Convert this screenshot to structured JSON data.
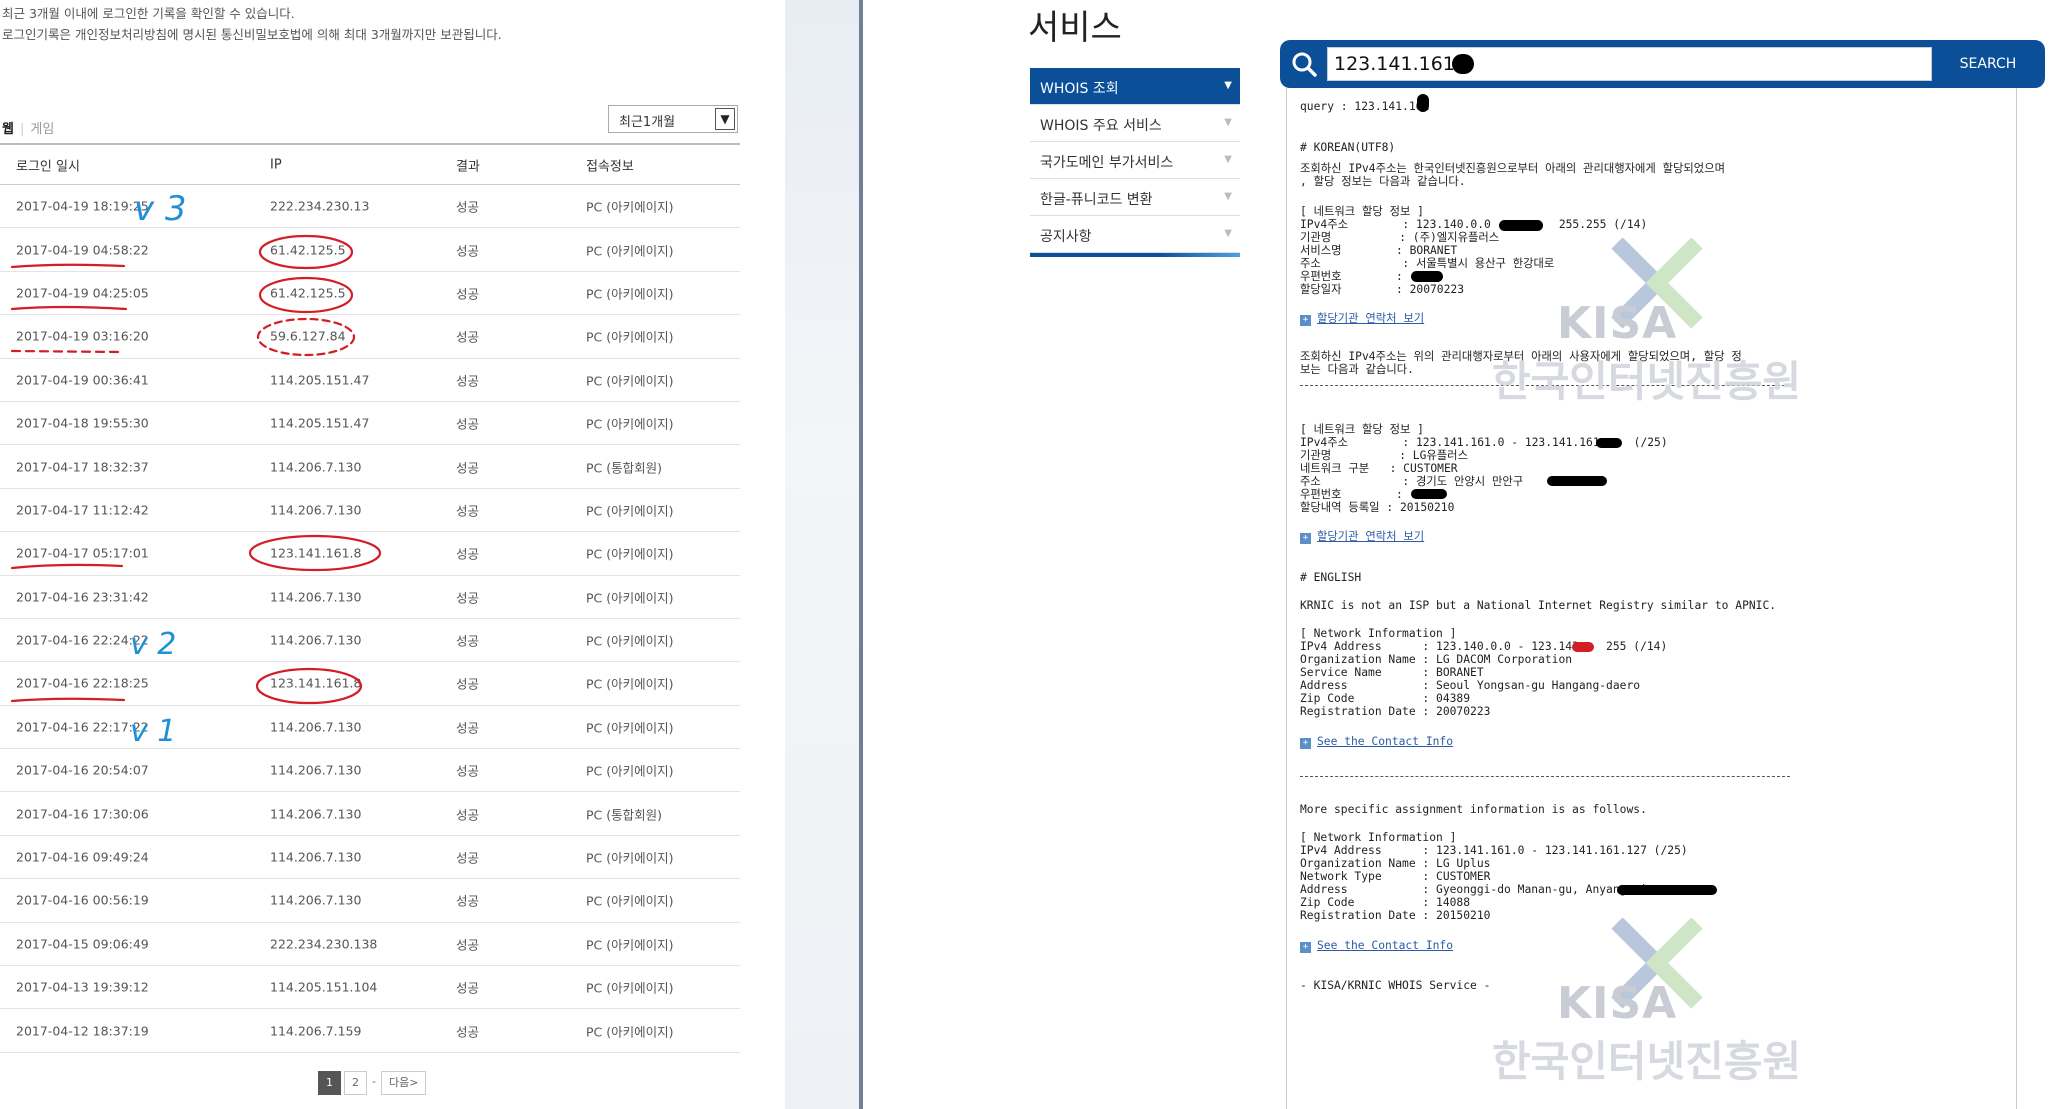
{
  "left": {
    "notice_line1": "최근 3개월 이내에 로그인한 기록을 확인할 수 있습니다.",
    "notice_line2": "로그인기록은 개인정보처리방침에 명시된 통신비밀보호법에 의해 최대 3개월까지만 보관됩니다.",
    "tabs": [
      "웹",
      "게임"
    ],
    "period_select": "최근1개월",
    "columns": [
      "로그인 일시",
      "IP",
      "결과",
      "접속정보"
    ],
    "rows": [
      {
        "time": "2017-04-19 18:19:25",
        "ip": "222.234.230.13",
        "result": "성공",
        "device": "PC (아키에이지)"
      },
      {
        "time": "2017-04-19 04:58:22",
        "ip": "61.42.125.5",
        "result": "성공",
        "device": "PC (아키에이지)"
      },
      {
        "time": "2017-04-19 04:25:05",
        "ip": "61.42.125.5",
        "result": "성공",
        "device": "PC (아키에이지)"
      },
      {
        "time": "2017-04-19 03:16:20",
        "ip": "59.6.127.84",
        "result": "성공",
        "device": "PC (아키에이지)"
      },
      {
        "time": "2017-04-19 00:36:41",
        "ip": "114.205.151.47",
        "result": "성공",
        "device": "PC (아키에이지)"
      },
      {
        "time": "2017-04-18 19:55:30",
        "ip": "114.205.151.47",
        "result": "성공",
        "device": "PC (아키에이지)"
      },
      {
        "time": "2017-04-17 18:32:37",
        "ip": "114.206.7.130",
        "result": "성공",
        "device": "PC (통합회원)"
      },
      {
        "time": "2017-04-17 11:12:42",
        "ip": "114.206.7.130",
        "result": "성공",
        "device": "PC (아키에이지)"
      },
      {
        "time": "2017-04-17 05:17:01",
        "ip": "123.141.161.8",
        "result": "성공",
        "device": "PC (아키에이지)"
      },
      {
        "time": "2017-04-16 23:31:42",
        "ip": "114.206.7.130",
        "result": "성공",
        "device": "PC (아키에이지)"
      },
      {
        "time": "2017-04-16 22:24:22",
        "ip": "114.206.7.130",
        "result": "성공",
        "device": "PC (아키에이지)"
      },
      {
        "time": "2017-04-16 22:18:25",
        "ip": "123.141.161.8",
        "result": "성공",
        "device": "PC (아키에이지)"
      },
      {
        "time": "2017-04-16 22:17:22",
        "ip": "114.206.7.130",
        "result": "성공",
        "device": "PC (아키에이지)"
      },
      {
        "time": "2017-04-16 20:54:07",
        "ip": "114.206.7.130",
        "result": "성공",
        "device": "PC (아키에이지)"
      },
      {
        "time": "2017-04-16 17:30:06",
        "ip": "114.206.7.130",
        "result": "성공",
        "device": "PC (통합회원)"
      },
      {
        "time": "2017-04-16 09:49:24",
        "ip": "114.206.7.130",
        "result": "성공",
        "device": "PC (아키에이지)"
      },
      {
        "time": "2017-04-16 00:56:19",
        "ip": "114.206.7.130",
        "result": "성공",
        "device": "PC (아키에이지)"
      },
      {
        "time": "2017-04-15 09:06:49",
        "ip": "222.234.230.138",
        "result": "성공",
        "device": "PC (아키에이지)"
      },
      {
        "time": "2017-04-13 19:39:12",
        "ip": "114.205.151.104",
        "result": "성공",
        "device": "PC (아키에이지)"
      },
      {
        "time": "2017-04-12 18:37:19",
        "ip": "114.206.7.159",
        "result": "성공",
        "device": "PC (아키에이지)"
      }
    ],
    "pager": {
      "page1": "1",
      "page2": "2",
      "dots": "-",
      "next": "다음>"
    },
    "annotations": {
      "v3": "v 3",
      "v2": "v 2",
      "v1": "v 1"
    }
  },
  "right": {
    "service_title": "서비스",
    "menu": [
      {
        "label": "WHOIS 조회",
        "active": true
      },
      {
        "label": "WHOIS 주요 서비스",
        "active": false
      },
      {
        "label": "국가도메인 부가서비스",
        "active": false
      },
      {
        "label": "한글-퓨니코드 변환",
        "active": false
      },
      {
        "label": "공지사항",
        "active": false
      }
    ],
    "search": {
      "value": "123.141.161",
      "button": "SEARCH"
    },
    "result": {
      "query": "query : 123.141.161",
      "korean_header": "# KOREAN(UTF8)",
      "k_intro1": "조회하신 IPv4주소는 한국인터넷진흥원으로부터 아래의 관리대행자에게 할당되었으며",
      "k_intro2": ", 할당 정보는 다음과 같습니다.",
      "k_net1_title": "[ 네트워크 할당 정보 ]",
      "k_net1_ipv4": "IPv4주소        : 123.140.0.0 -        255.255 (/14)",
      "k_net1_org": "기관명          : (주)엘지유플러스",
      "k_net1_svc": "서비스명        : BORANET",
      "k_net1_addr": "주소            : 서울특별시 용산구 한강대로",
      "k_net1_zip": "우편번호        :",
      "k_net1_date": "할당일자        : 20070223",
      "k_contact": "할당기관 연락처 보기",
      "k_intro3": "조회하신 IPv4주소는 위의 관리대행자로부터 아래의 사용자에게 할당되었으며, 할당 정",
      "k_intro4": "보는 다음과 같습니다.",
      "k_net2_title": "[ 네트워크 할당 정보 ]",
      "k_net2_ipv4": "IPv4주소        : 123.141.161.0 - 123.141.161.    (/25)",
      "k_net2_org": "기관명          : LG유플러스",
      "k_net2_type": "네트워크 구분   : CUSTOMER",
      "k_net2_addr": "주소            : 경기도 안양시 만안구",
      "k_net2_zip": "우편번호        :",
      "k_net2_date": "할당내역 등록일 : 20150210",
      "english_header": "# ENGLISH",
      "e_intro": "KRNIC is not an ISP but a National Internet Registry similar to APNIC.",
      "e_net1_title": "[ Network Information ]",
      "e_net1_ipv4": "IPv4 Address      : 123.140.0.0 - 123.143.   255 (/14)",
      "e_net1_org": "Organization Name : LG DACOM Corporation",
      "e_net1_svc": "Service Name      : BORANET",
      "e_net1_addr": "Address           : Seoul Yongsan-gu Hangang-daero",
      "e_net1_zip": "Zip Code          : 04389",
      "e_net1_date": "Registration Date : 20070223",
      "e_contact": "See the Contact Info",
      "e_more": "More specific assignment information is as follows.",
      "e_net2_title": "[ Network Information ]",
      "e_net2_ipv4": "IPv4 Address      : 123.141.161.0 - 123.141.161.127 (/25)",
      "e_net2_org": "Organization Name : LG Uplus",
      "e_net2_type": "Network Type      : CUSTOMER",
      "e_net2_addr": "Address           : Gyeonggi-do Manan-gu, Anyang-si",
      "e_net2_zip": "Zip Code          : 14088",
      "e_net2_date": "Registration Date : 20150210",
      "footer": "- KISA/KRNIC WHOIS Service -"
    },
    "watermark": {
      "logo": "KISA",
      "name": "한국인터넷진흥원"
    }
  },
  "colors": {
    "accent": "#0a4f97",
    "annotation_red": "#d21e24",
    "annotation_blue": "#1f8fd6"
  }
}
